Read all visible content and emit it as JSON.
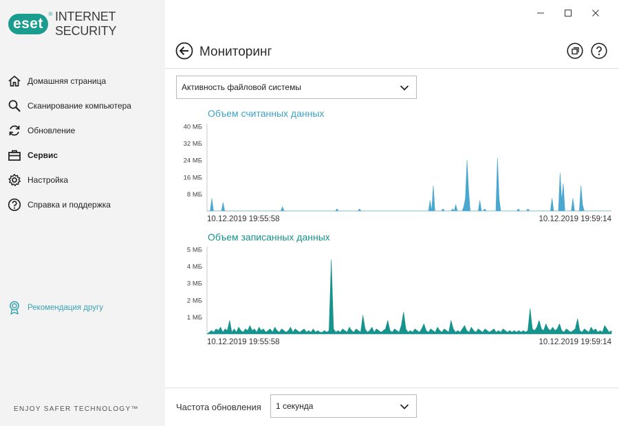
{
  "app": {
    "logo_text": "eset",
    "logo_reg": "®",
    "product_name": "INTERNET SECURITY",
    "tagline": "ENJOY SAFER TECHNOLOGY™"
  },
  "sidebar": {
    "items": [
      {
        "label": "Домашняя страница",
        "icon": "home-icon"
      },
      {
        "label": "Сканирование компьютера",
        "icon": "search-icon"
      },
      {
        "label": "Обновление",
        "icon": "refresh-icon"
      },
      {
        "label": "Сервис",
        "icon": "toolbox-icon",
        "active": true
      },
      {
        "label": "Настройка",
        "icon": "gear-icon"
      },
      {
        "label": "Справка и поддержка",
        "icon": "help-icon"
      }
    ],
    "recommend_label": "Рекомендация другу",
    "recommend_icon": "award-icon"
  },
  "header": {
    "title": "Мониторинг",
    "back_icon": "back-arrow-icon",
    "window_icon": "window-copy-icon",
    "help_icon": "help-icon"
  },
  "monitor_select": {
    "value": "Активность файловой системы"
  },
  "frequency": {
    "label": "Частота обновления",
    "value": "1 секунда"
  },
  "colors": {
    "read": "#4aa7cf",
    "write": "#16938c",
    "read_title": "#3fa0c4",
    "write_title": "#15908a"
  },
  "chart_data": [
    {
      "type": "area",
      "title": "Объем считанных данных",
      "y_unit": "МБ",
      "yticks": [
        "8 МБ",
        "16 МБ",
        "24 МБ",
        "32 МБ",
        "40 МБ"
      ],
      "ytick_values": [
        8,
        16,
        24,
        32,
        40
      ],
      "ylim": [
        0,
        40
      ],
      "x_start_label": "10.12.2019 19:55:58",
      "x_end_label": "10.12.2019 19:59:14",
      "series": [
        {
          "values": [
            0,
            0,
            0,
            6,
            0,
            0,
            0,
            0,
            0,
            0,
            4,
            0,
            0,
            0,
            0,
            0,
            0,
            0,
            0,
            0,
            0,
            0,
            0,
            0,
            0,
            0,
            0,
            0,
            0,
            0,
            0,
            0,
            0,
            0,
            0,
            0,
            0,
            0,
            0,
            0,
            0,
            0,
            0,
            0,
            0,
            0,
            0,
            2,
            0,
            0,
            0,
            0,
            0,
            0,
            0,
            0,
            0,
            0,
            0,
            0,
            0,
            0,
            0,
            0,
            0,
            0,
            0,
            0,
            0,
            0,
            0,
            0,
            0,
            0,
            0,
            0,
            0,
            0,
            0,
            0,
            0,
            1,
            0,
            0,
            0,
            0,
            0,
            0,
            0,
            0,
            0,
            0,
            0,
            0,
            0,
            1,
            0,
            0,
            0,
            0,
            0,
            0,
            0,
            0,
            0,
            0,
            0,
            0,
            0,
            0,
            0,
            0,
            0,
            0,
            0,
            0,
            0,
            0,
            0,
            0,
            0,
            0,
            0,
            0,
            0,
            0,
            0,
            0,
            0,
            0,
            0,
            0,
            0,
            0,
            0,
            0,
            0,
            0,
            0,
            5,
            0,
            12,
            0,
            0,
            0,
            0,
            0,
            1,
            0,
            0,
            0,
            0,
            0,
            1,
            0,
            3,
            0,
            0,
            0,
            0,
            2,
            6,
            24,
            10,
            0,
            0,
            0,
            0,
            0,
            0,
            5,
            0,
            0,
            1,
            0,
            0,
            0,
            0,
            0,
            0,
            0,
            25,
            6,
            0,
            0,
            0,
            0,
            0,
            0,
            0,
            0,
            0,
            0,
            0,
            1,
            0,
            0,
            0,
            0,
            0,
            1,
            0,
            0,
            0,
            0,
            0,
            0,
            0,
            0,
            0,
            0,
            0,
            0,
            0,
            0,
            6,
            0,
            0,
            0,
            0,
            18,
            5,
            13,
            0,
            0,
            0,
            0,
            0,
            6,
            0,
            0,
            0,
            0,
            12,
            3,
            0,
            0,
            0,
            0,
            0,
            0,
            0,
            0,
            0,
            0,
            0,
            0,
            0,
            0,
            0,
            0,
            0,
            0
          ]
        }
      ]
    },
    {
      "type": "area",
      "title": "Объем записанных данных",
      "y_unit": "МБ",
      "yticks": [
        "1 МБ",
        "2 МБ",
        "3 МБ",
        "4 МБ",
        "5 МБ"
      ],
      "ytick_values": [
        1,
        2,
        3,
        4,
        5
      ],
      "ylim": [
        0,
        5
      ],
      "x_start_label": "10.12.2019 19:55:58",
      "x_end_label": "10.12.2019 19:59:14",
      "series": [
        {
          "values": [
            0,
            0.1,
            0.2,
            0.1,
            0.3,
            0.2,
            0.4,
            0.1,
            0.3,
            0.2,
            0.8,
            0.1,
            0.3,
            0.1,
            0.4,
            0.2,
            0.1,
            0.3,
            0.2,
            0.5,
            0.2,
            0.3,
            0.1,
            0.4,
            0.2,
            0.3,
            0.1,
            0.2,
            0.3,
            0.1,
            0.4,
            0.2,
            0.1,
            0.3,
            0.2,
            0.1,
            0.2,
            0.4,
            0.1,
            0.3,
            0.2,
            0.1,
            0.2,
            0.3,
            0.1,
            0.2,
            0.1,
            0.3,
            0.1,
            0.2,
            0.1,
            0.1,
            0.2,
            0.1,
            0.2,
            4.4,
            0.3,
            0.1,
            0.2,
            0.1,
            0.3,
            0.2,
            0.1,
            0.4,
            0.2,
            0.1,
            0.3,
            0.2,
            0.1,
            1.1,
            0.3,
            0.1,
            0.2,
            0.4,
            0.1,
            0.3,
            0.2,
            0.1,
            0.2,
            0.3,
            0.8,
            0.2,
            0.1,
            0.3,
            0.2,
            0.1,
            0.5,
            1.3,
            0.3,
            0.1,
            0.2,
            0.1,
            0.3,
            0.2,
            0.1,
            0.3,
            0.6,
            0.2,
            0.1,
            0.3,
            0.2,
            0.1,
            0.4,
            0.2,
            0.1,
            0.3,
            0.2,
            0.1,
            0.8,
            0.3,
            0.1,
            0.2,
            0.1,
            0.3,
            0.5,
            0.2,
            0.1,
            0.4,
            0.2,
            0.1,
            0.3,
            0.2,
            0.1,
            0.3,
            0.2,
            0.1,
            0.2,
            0.3,
            0.1,
            0.2,
            0.1,
            0.3,
            0.2,
            0.1,
            0.2,
            0.1,
            0.2,
            0.1,
            0.2,
            0.1,
            0.2,
            0.1,
            0.2,
            1.5,
            0.3,
            0.2,
            0.4,
            0.8,
            0.3,
            0.2,
            0.6,
            0.3,
            0.2,
            0.4,
            0.2,
            0.3,
            0.6,
            0.2,
            0.1,
            0.3,
            0.2,
            0.1,
            0.2,
            0.3,
            0.9,
            0.2,
            0.1,
            0.3,
            0.2,
            0.1,
            0.4,
            0.2,
            0.3,
            0.1,
            0.2,
            0.1,
            0.5,
            0.3,
            0.1,
            0.2
          ]
        }
      ]
    }
  ]
}
